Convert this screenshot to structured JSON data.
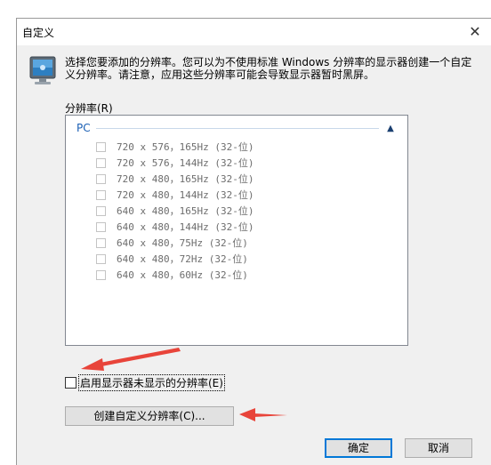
{
  "window": {
    "title": "自定义",
    "close_glyph": "✕"
  },
  "info": {
    "text": "选择您要添加的分辨率。您可以为不使用标准 Windows 分辨率的显示器创建一个自定义分辨率。请注意，应用这些分辨率可能会导致显示器暂时黑屏。"
  },
  "resolutions": {
    "label": "分辨率(R)",
    "group": {
      "name": "PC",
      "collapse_glyph": "▲"
    },
    "items": [
      "720 x 576，165Hz (32-位)",
      "720 x 576，144Hz (32-位)",
      "720 x 480，165Hz (32-位)",
      "720 x 480，144Hz (32-位)",
      "640 x 480，165Hz (32-位)",
      "640 x 480，144Hz (32-位)",
      "640 x 480，75Hz (32-位)",
      "640 x 480，72Hz (32-位)",
      "640 x 480，60Hz (32-位)"
    ]
  },
  "options": {
    "enable_label": "启用显示器未显示的分辨率(E)"
  },
  "buttons": {
    "create_label": "创建自定义分辨率(C)...",
    "ok_label": "确定",
    "cancel_label": "取消"
  },
  "colors": {
    "annotation_arrow": "#e8443a",
    "group_header": "#1a5fb4",
    "default_button_border": "#0078d7"
  },
  "icons": {
    "dialog_icon": "monitor-icon",
    "close": "close-icon",
    "collapse": "chevron-up-icon"
  }
}
